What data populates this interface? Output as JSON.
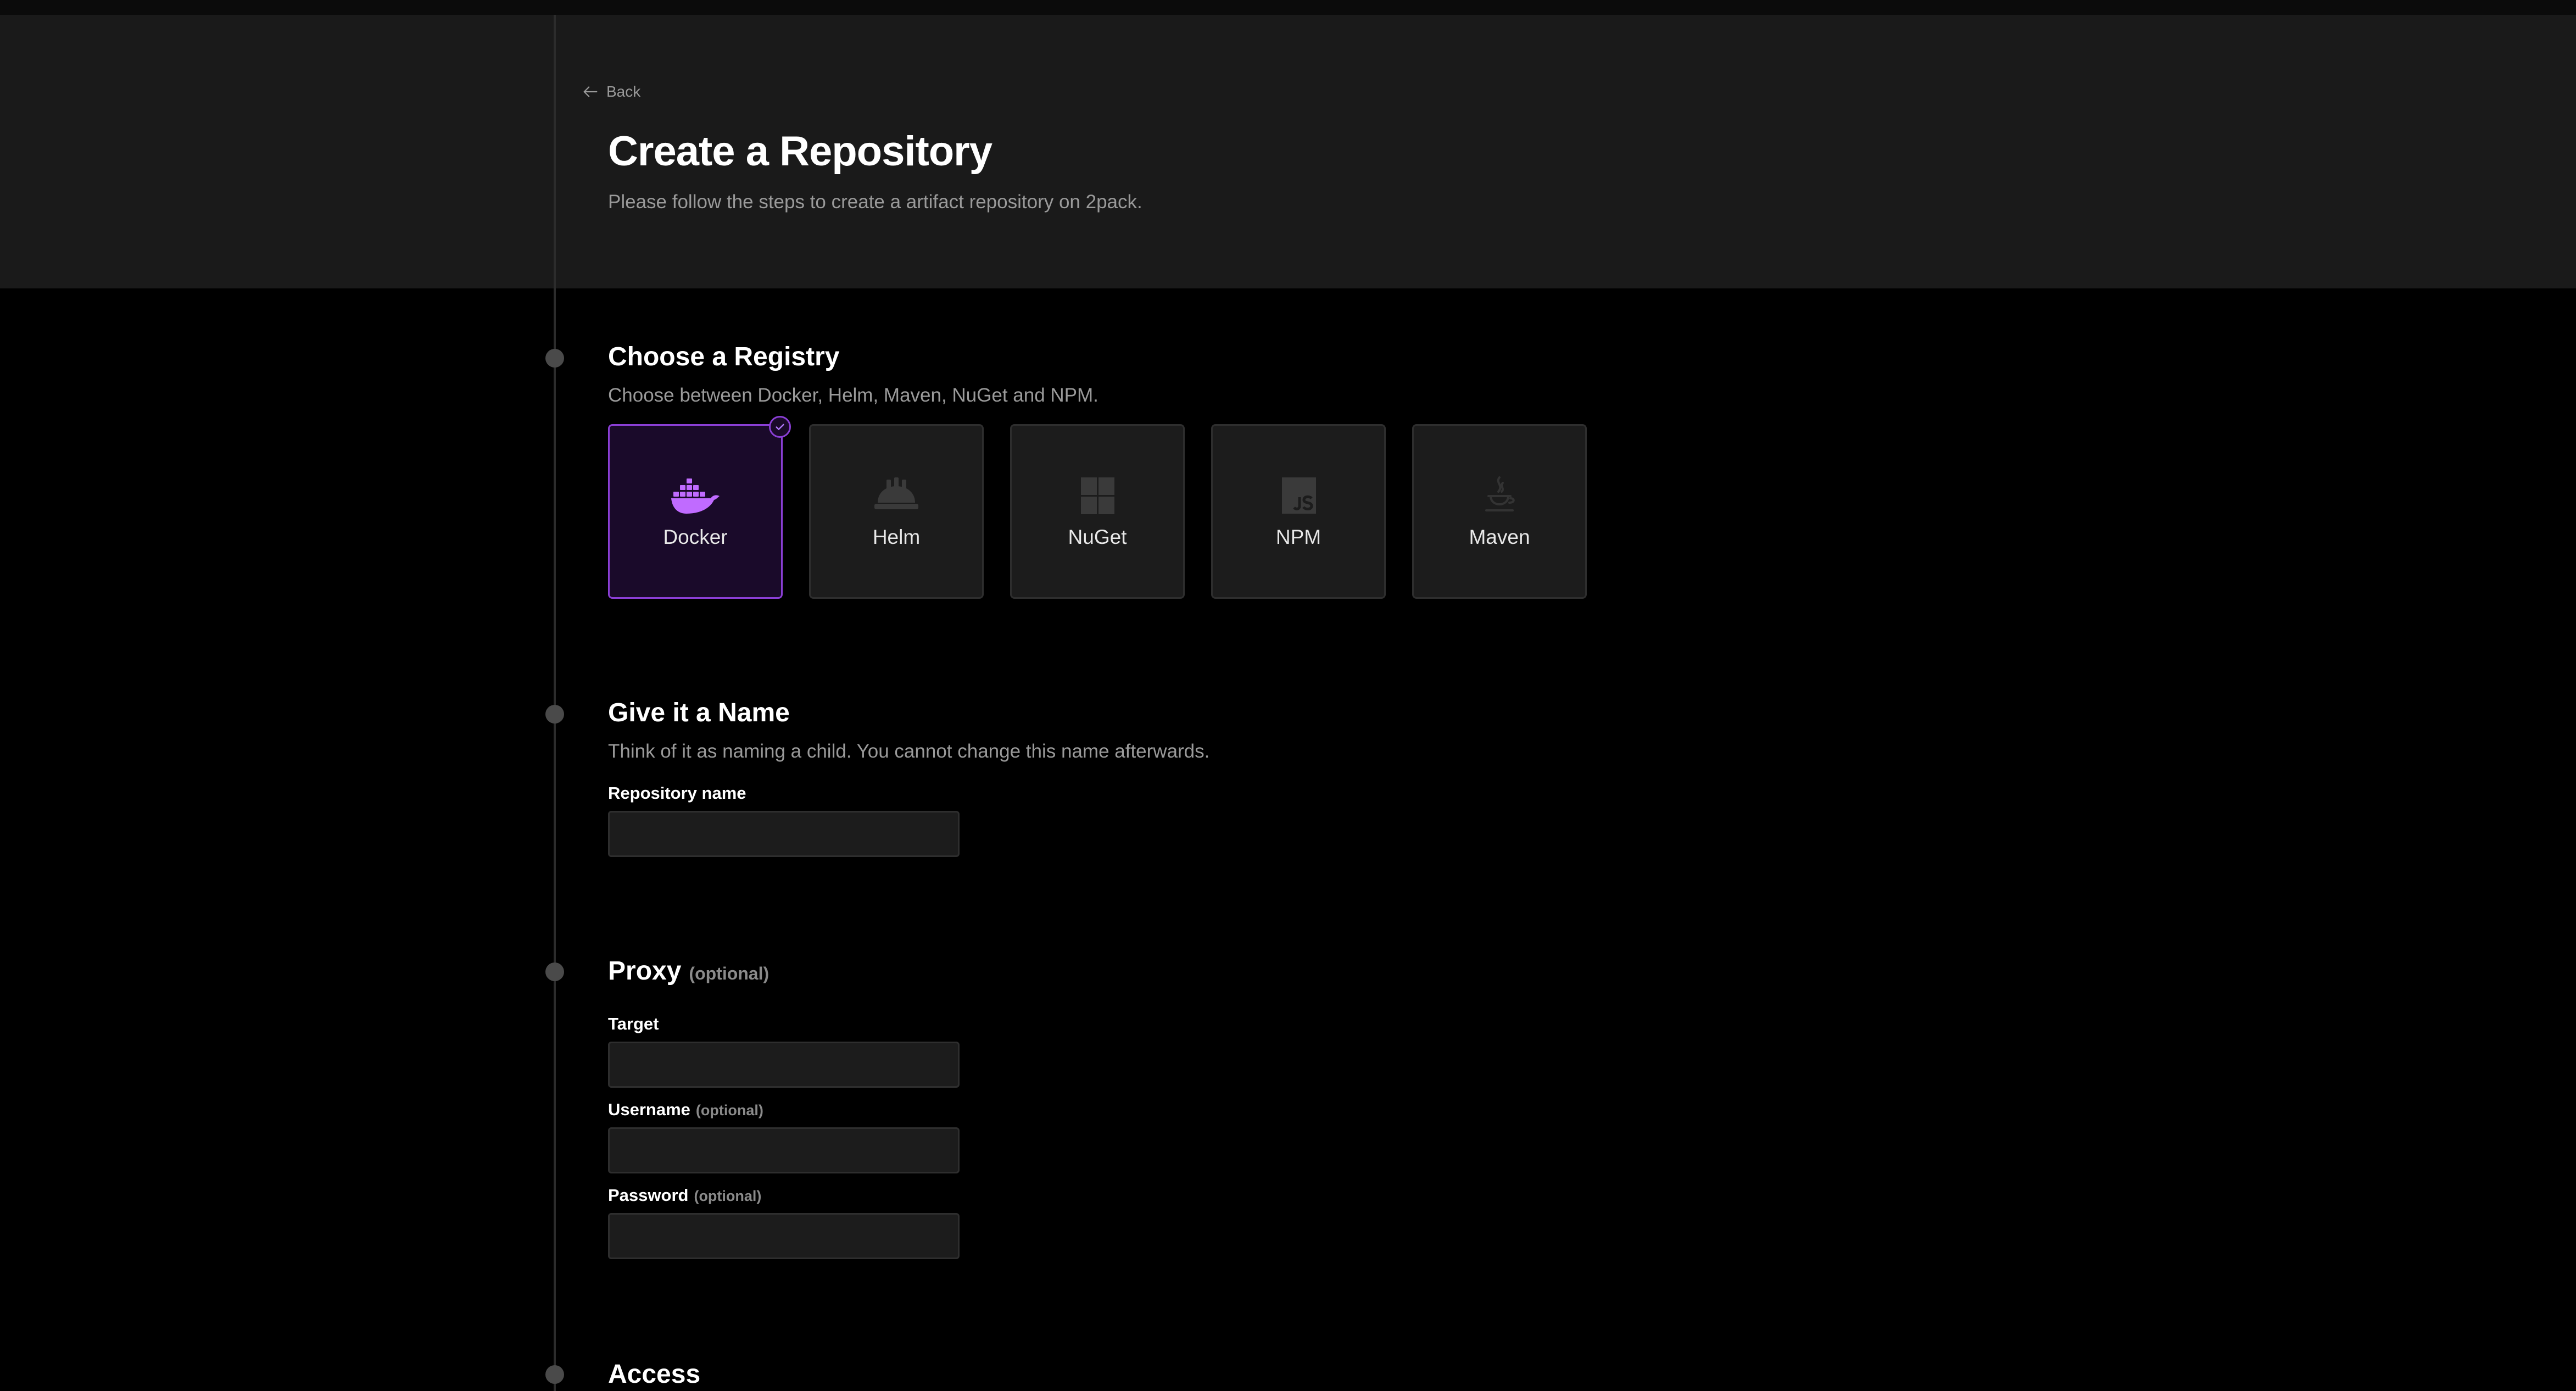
{
  "nav": {
    "back_label": "Back"
  },
  "header": {
    "title": "Create a Repository",
    "subtitle": "Please follow the steps to create a artifact repository on 2pack."
  },
  "steps": {
    "registry": {
      "title": "Choose a Registry",
      "description": "Choose between Docker, Helm, Maven, NuGet and NPM.",
      "options": [
        {
          "label": "Docker",
          "icon": "docker-icon",
          "selected": true
        },
        {
          "label": "Helm",
          "icon": "helm-icon",
          "selected": false
        },
        {
          "label": "NuGet",
          "icon": "nuget-icon",
          "selected": false
        },
        {
          "label": "NPM",
          "icon": "npm-icon",
          "selected": false
        },
        {
          "label": "Maven",
          "icon": "maven-icon",
          "selected": false
        }
      ]
    },
    "name": {
      "title": "Give it a Name",
      "description": "Think of it as naming a child. You cannot change this name afterwards.",
      "repository_name_label": "Repository name",
      "repository_name_value": ""
    },
    "proxy": {
      "title": "Proxy",
      "optional_tag": "(optional)",
      "target_label": "Target",
      "target_value": "",
      "username_label": "Username",
      "username_optional": "(optional)",
      "username_value": "",
      "password_label": "Password",
      "password_optional": "(optional)",
      "password_value": ""
    },
    "access": {
      "title": "Access"
    }
  },
  "colors": {
    "accent": "#8b3fd6",
    "selected_card_bg": "#1a0a2a",
    "card_bg": "#1c1c1c",
    "header_bg": "#1a1a1a",
    "page_bg": "#000000"
  }
}
